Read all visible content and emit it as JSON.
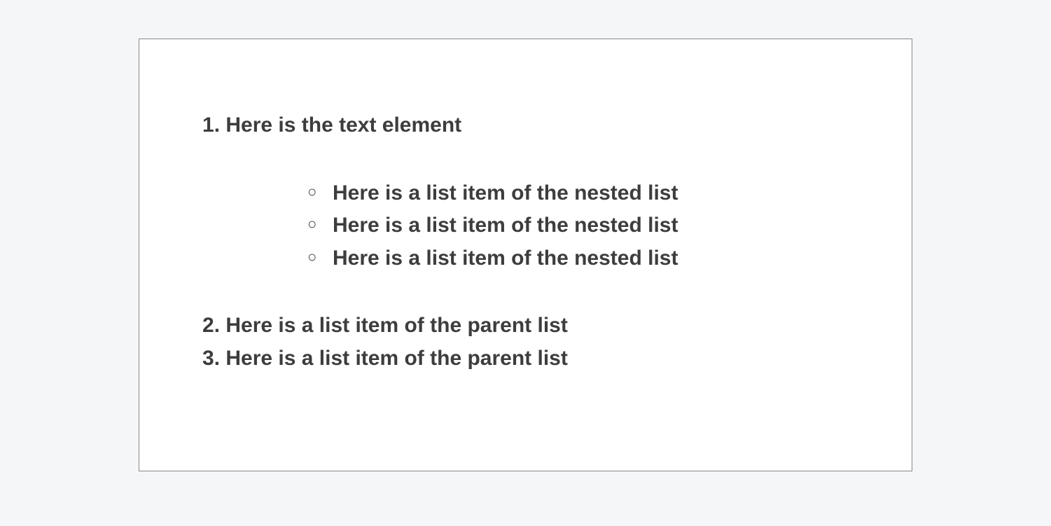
{
  "list": {
    "items": [
      {
        "text": "Here is the text element",
        "nested": [
          "Here is a list item of the nested list",
          "Here is a list item of the nested list",
          "Here is a list item of the nested list"
        ]
      },
      {
        "text": "Here is a list item of the parent list"
      },
      {
        "text": "Here is a list item of the parent list"
      }
    ]
  }
}
